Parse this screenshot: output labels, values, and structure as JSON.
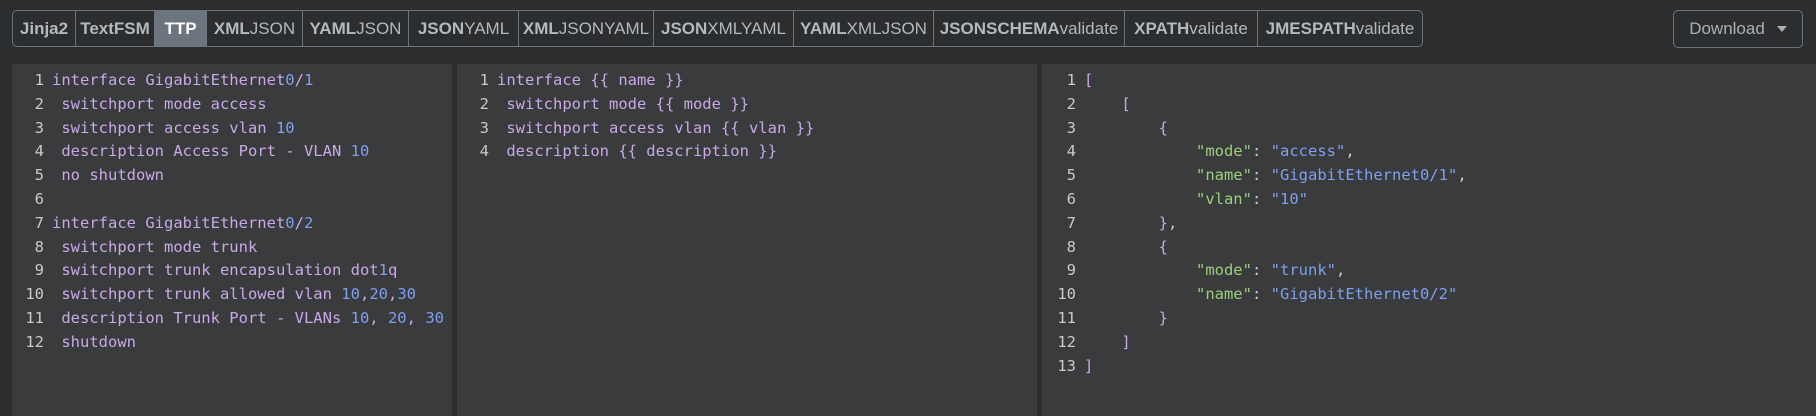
{
  "tabs": [
    {
      "bold": "Jinja2",
      "rest": "",
      "active": false
    },
    {
      "bold": "TextFSM",
      "rest": "",
      "active": false
    },
    {
      "bold": "TTP",
      "rest": "",
      "active": true
    },
    {
      "bold": "XML",
      "rest": "JSON",
      "active": false
    },
    {
      "bold": "YAML",
      "rest": "JSON",
      "active": false
    },
    {
      "bold": "JSON",
      "rest": "YAML",
      "active": false
    },
    {
      "bold": "XML",
      "rest": "JSONYAML",
      "active": false
    },
    {
      "bold": "JSON",
      "rest": "XMLYAML",
      "active": false
    },
    {
      "bold": "YAML",
      "rest": "XMLJSON",
      "active": false
    },
    {
      "bold": "JSONSCHEMA",
      "rest": "validate",
      "active": false
    },
    {
      "bold": "XPATH",
      "rest": "validate",
      "active": false
    },
    {
      "bold": "JMESPATH",
      "rest": "validate",
      "active": false
    }
  ],
  "download": {
    "label": "Download"
  },
  "input_panel": {
    "lines": [
      "interface GigabitEthernet0/1",
      " switchport mode access",
      " switchport access vlan 10",
      " description Access Port - VLAN 10",
      " no shutdown",
      "",
      "interface GigabitEthernet0/2",
      " switchport mode trunk",
      " switchport trunk encapsulation dot1q",
      " switchport trunk allowed vlan 10,20,30",
      " description Trunk Port - VLANs 10, 20, 30",
      " shutdown"
    ]
  },
  "template_panel": {
    "lines": [
      "interface {{ name }}",
      " switchport mode {{ mode }}",
      " switchport access vlan {{ vlan }}",
      " description {{ description }}"
    ]
  },
  "output_panel": {
    "lines": [
      "[",
      "    [",
      "        {",
      "            \"mode\": \"access\",",
      "            \"name\": \"GigabitEthernet0/1\",",
      "            \"vlan\": \"10\"",
      "        },",
      "        {",
      "            \"mode\": \"trunk\",",
      "            \"name\": \"GigabitEthernet0/2\"",
      "        }",
      "    ]",
      "]"
    ]
  },
  "colors": {
    "background": "#2b2d2e",
    "panel": "#393b3c",
    "active_tab": "#6c757d",
    "keyword": "#c9a8e8",
    "number": "#7f9ff0",
    "json_key": "#9ad07a",
    "json_string": "#7f9ff0"
  }
}
